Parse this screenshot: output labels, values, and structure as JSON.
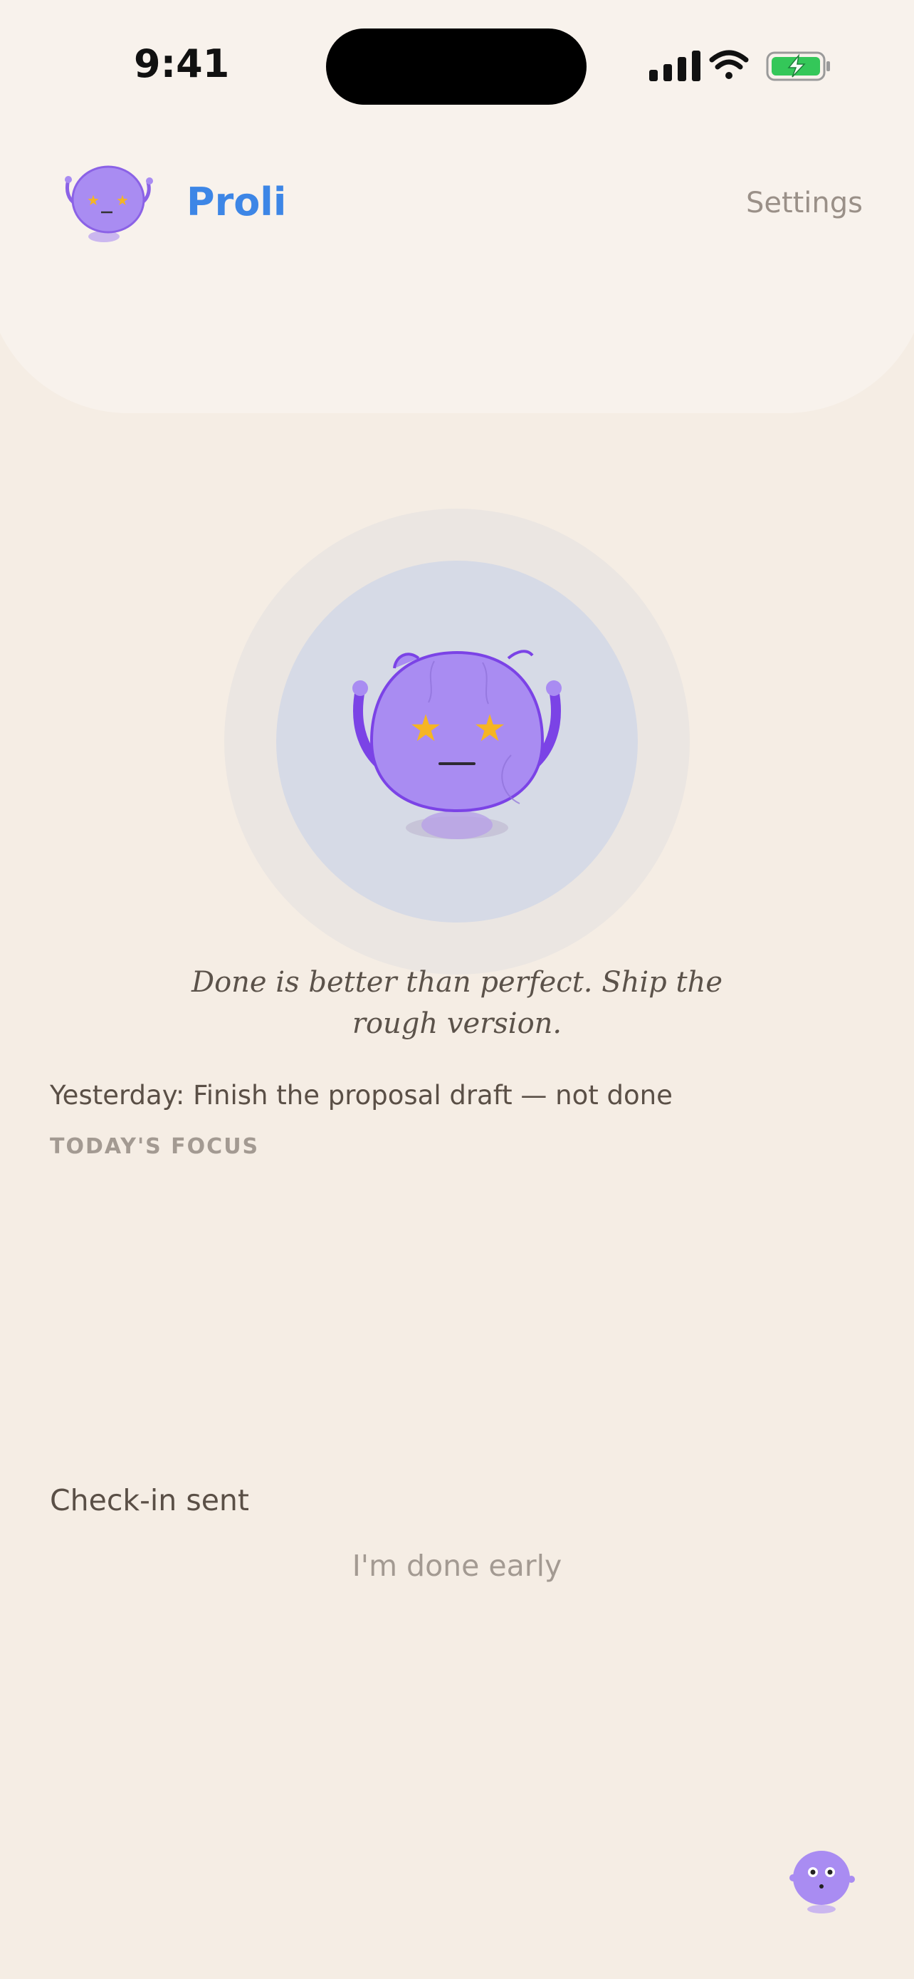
{
  "status_bar": {
    "time": "9:41"
  },
  "header": {
    "app_name": "Proli",
    "settings_label": "Settings"
  },
  "hero": {
    "quote": "Done is better than perfect. Ship the rough version."
  },
  "yesterday_text": "Yesterday: Finish the proposal draft — not done",
  "focus_label": "TODAY'S FOCUS",
  "checkin_status": "Check-in sent",
  "done_early_label": "I'm done early",
  "colors": {
    "background": "#f5ede4",
    "header": "#f8f2ec",
    "accent": "#3d86e6",
    "mascot": "#a98cf2",
    "battery": "#34c759"
  }
}
